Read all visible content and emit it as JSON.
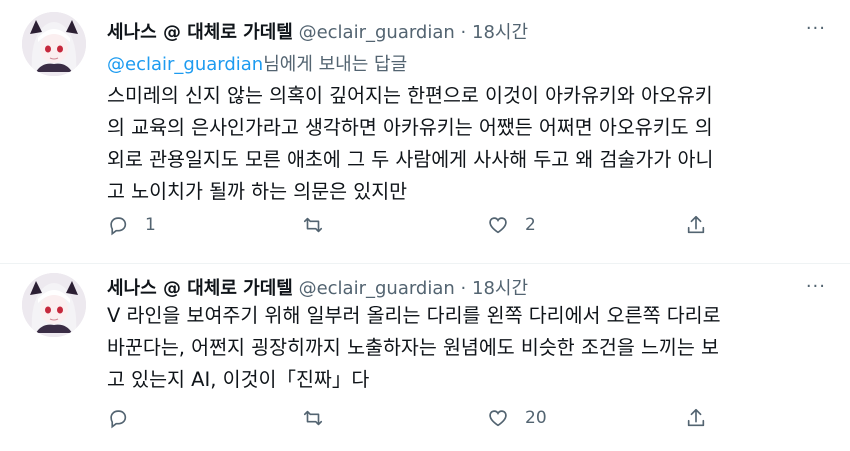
{
  "tweets": [
    {
      "author_name": "세나스 @ 대체로 가데텔",
      "handle": "@eclair_guardian",
      "separator": "·",
      "time": "18시간",
      "more_label": "···",
      "replying_mention": "@eclair_guardian",
      "replying_suffix": "님에게 보내는 답글",
      "text": "스미레의 신지 않는 의혹이 깊어지는 한편으로 이것이 아카유키와 아오유키\n의 교육의 은사인가라고 생각하면 아카유키는 어쨌든 어쩌면 아오유키도 의\n외로 관용일지도 모른 애초에 그 두 사람에게 사사해 두고 왜 검술가가 아니\n고 노이치가 될까 하는 의문은 있지만",
      "reply_count": "1",
      "retweet_count": "",
      "like_count": "2"
    },
    {
      "author_name": "세나스 @ 대체로 가데텔",
      "handle": "@eclair_guardian",
      "separator": "·",
      "time": "18시간",
      "more_label": "···",
      "text": "V 라인을 보여주기 위해 일부러 올리는 다리를 왼쪽 다리에서 오른쪽 다리로\n바꾼다는, 어쩐지 굉장히까지 노출하자는 원념에도 비슷한 조건을 느끼는 보\n고 있는지 AI, 이것이「진짜」다",
      "reply_count": "",
      "retweet_count": "",
      "like_count": "20"
    }
  ],
  "icons": {
    "avatar": "avatar-anime-girl",
    "reply": "speech-bubble-icon",
    "retweet": "retweet-icon",
    "like": "heart-icon",
    "share": "share-icon"
  },
  "colors": {
    "link": "#1d9bf0",
    "muted": "#536471",
    "text": "#0f1419",
    "divider": "#eff3f4"
  }
}
